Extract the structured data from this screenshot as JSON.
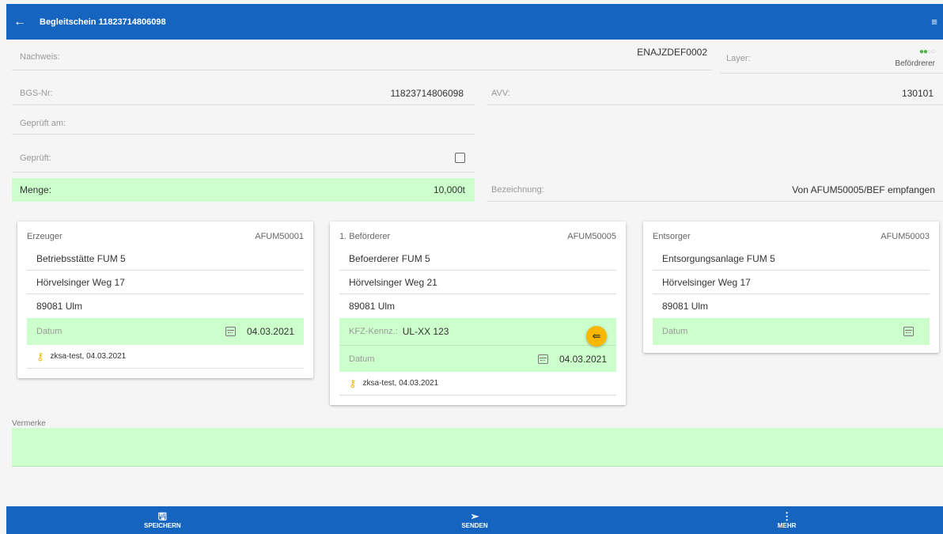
{
  "header": {
    "title": "Begleitschein 11823714806098",
    "back_icon": "arrow-left-icon",
    "menu_icon": "menu-icon"
  },
  "fields": {
    "nachweis_label": "Nachweis:",
    "nachweis_value": "ENAJZDEF0002",
    "layer_label": "Layer:",
    "layer_value": "Befördrerer",
    "bgs_label": "BGS-Nr:",
    "bgs_value": "11823714806098",
    "avv_label": "AVV:",
    "avv_value": "130101",
    "geprueft_am_label": "Geprüft am:",
    "geprueft_label": "Geprüft:",
    "menge_label": "Menge:",
    "menge_value": "10,000t",
    "bezeichnung_label": "Bezeichnung:",
    "bezeichnung_value": "Von AFUM50005/BEF empfangen"
  },
  "cards": {
    "erzeuger": {
      "title": "Erzeuger",
      "id": "AFUM50001",
      "name": "Betriebsstätte FUM 5",
      "street": "Hörvelsinger Weg 17",
      "city": "89081 Ulm",
      "datum_label": "Datum",
      "datum_value": "04.03.2021",
      "signature": "zksa-test, 04.03.2021"
    },
    "befoerderer": {
      "title": "1. Beförderer",
      "id": "AFUM50005",
      "name": "Befoerderer FUM 5",
      "street": "Hörvelsinger Weg 21",
      "city": "89081 Ulm",
      "kfz_label": "KFZ-Kennz.:",
      "kfz_value": "UL-XX 123",
      "datum_label": "Datum",
      "datum_value": "04.03.2021",
      "signature": "zksa-test, 04.03.2021"
    },
    "entsorger": {
      "title": "Entsorger",
      "id": "AFUM50003",
      "name": "Entsorgungsanlage FUM 5",
      "street": "Hörvelsinger Weg 17",
      "city": "89081 Ulm",
      "datum_label": "Datum"
    }
  },
  "vermerke": {
    "label": "Vermerke"
  },
  "bottom_nav": {
    "save": "SPEICHERN",
    "send": "SENDEN",
    "more": "MEHR"
  },
  "colors": {
    "primary": "#1565c0",
    "highlight": "#ccffcc",
    "accent": "#f2b705",
    "layer_active": "#4caf50"
  }
}
